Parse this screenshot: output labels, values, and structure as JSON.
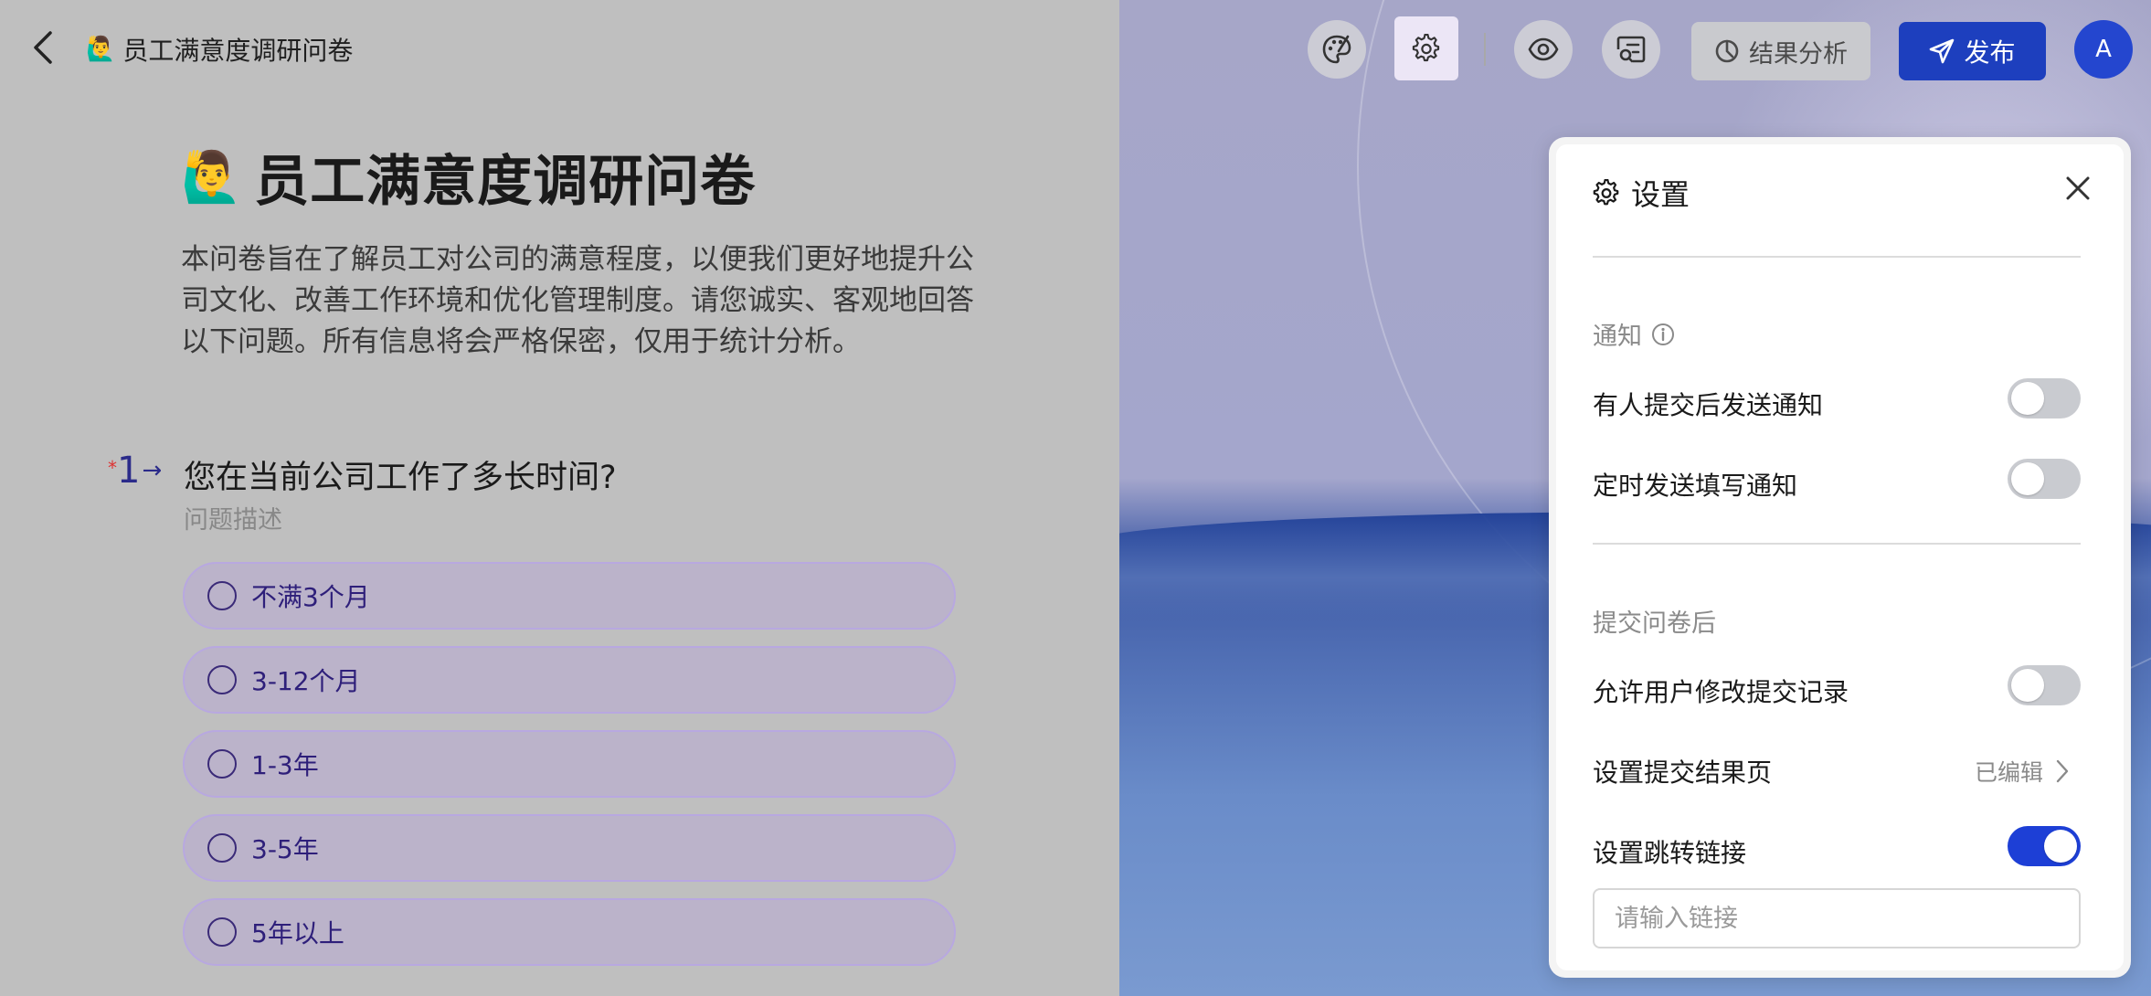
{
  "header": {
    "doc_title": "员工满意度调研问卷",
    "title_emoji": "🙋‍♂️",
    "result_label": "结果分析",
    "publish_label": "发布",
    "avatar_initial": "A"
  },
  "survey": {
    "title": "员工满意度调研问卷",
    "intro": "本问卷旨在了解员工对公司的满意程度，以便我们更好地提升公司文化、改善工作环境和优化管理制度。请您诚实、客观地回答以下问题。所有信息将会严格保密，仅用于统计分析。",
    "question": {
      "required_mark": "*",
      "number": "1",
      "arrow": "→",
      "title": "您在当前公司工作了多长时间?",
      "description": "问题描述",
      "options": [
        "不满3个月",
        "3-12个月",
        "1-3年",
        "3-5年",
        "5年以上"
      ]
    }
  },
  "settings": {
    "title": "设置",
    "notification": {
      "section_label": "通知",
      "items": [
        {
          "label": "有人提交后发送通知",
          "enabled": false
        },
        {
          "label": "定时发送填写通知",
          "enabled": false
        }
      ]
    },
    "after_submit": {
      "section_label": "提交问卷后",
      "allow_modify": {
        "label": "允许用户修改提交记录",
        "enabled": false
      },
      "result_page": {
        "label": "设置提交结果页",
        "status": "已编辑"
      },
      "redirect": {
        "label": "设置跳转链接",
        "enabled": true
      },
      "link_placeholder": "请输入链接"
    }
  },
  "colors": {
    "accent": "#1d3fbe",
    "toggle_on": "#1d3fd6",
    "option_text": "#2e1f7a"
  }
}
